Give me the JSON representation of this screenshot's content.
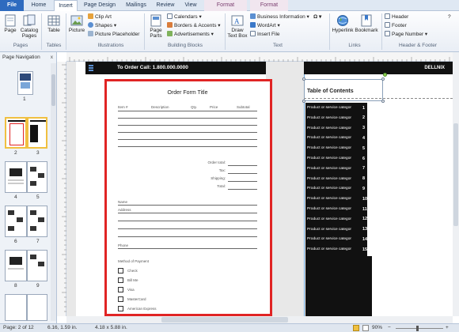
{
  "tabs": [
    "File",
    "Home",
    "Insert",
    "Page Design",
    "Mailings",
    "Review",
    "View",
    "Format",
    "Format"
  ],
  "ribbon": {
    "pages": {
      "page": "Page",
      "catalog": "Catalog Pages",
      "group": "Pages"
    },
    "tables": {
      "table": "Table",
      "group": "Tables"
    },
    "illustrations": {
      "picture": "Picture",
      "clip_art": "Clip Art",
      "shapes": "Shapes",
      "picture_placeholder": "Picture Placeholder",
      "group": "Illustrations"
    },
    "building_blocks": {
      "page_parts": "Page Parts",
      "calendars": "Calendars",
      "borders_accents": "Borders & Accents",
      "advertisements": "Advertisements",
      "group": "Building Blocks"
    },
    "text": {
      "draw_text_box": "Draw Text Box",
      "business_information": "Business Information",
      "wordart": "WordArt",
      "insert_file": "Insert File",
      "group": "Text"
    },
    "links": {
      "hyperlink": "Hyperlink",
      "bookmark": "Bookmark",
      "group": "Links"
    },
    "header_footer": {
      "header": "Header",
      "footer": "Footer",
      "page_number": "Page Number",
      "group": "Header & Footer"
    }
  },
  "page_nav": {
    "title": "Page Navigation",
    "close": "x",
    "thumb_labels": [
      "1",
      "2",
      "3",
      "4",
      "5",
      "6",
      "7",
      "8",
      "9"
    ]
  },
  "document": {
    "banner": "To Order Call: 1.800.000.0000",
    "banner_right": "DELLNIX",
    "order_form": {
      "title": "Order Form Title",
      "columns": [
        "Item #",
        "Description",
        "Qty.",
        "Price",
        "Subtotal"
      ],
      "totals": [
        "Order total:",
        "Tax:",
        "Shipping:",
        "Total:"
      ],
      "name_label": "Name",
      "address_label": "Address",
      "phone_label": "Phone",
      "payment_title": "Method of Payment",
      "payment_options": [
        "Check",
        "Bill Me",
        "Visa",
        "MasterCard",
        "American Express"
      ]
    },
    "toc": {
      "title": "Table of Contents",
      "entry_label": "Product or service categor",
      "numbers": [
        "1",
        "2",
        "3",
        "4",
        "5",
        "6",
        "7",
        "8",
        "9",
        "10",
        "11",
        "12",
        "13",
        "14",
        "15"
      ]
    }
  },
  "status_bar": {
    "page": "Page: 2 of 12",
    "position": "6.16, 1.59 in.",
    "size": "4.18 x 5.88 in.",
    "zoom": "90%"
  },
  "colors": {
    "file_tab": "#2e6bbf",
    "highlight": "#e02424",
    "selected_thumb": "#f0c040"
  }
}
